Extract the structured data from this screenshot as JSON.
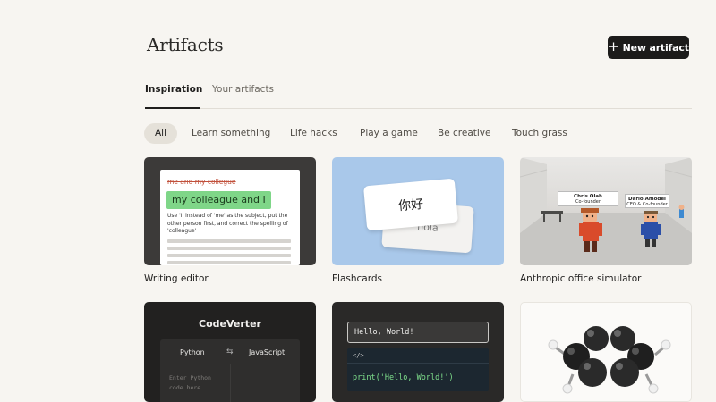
{
  "header": {
    "title": "Artifacts",
    "new_button_label": "New artifact"
  },
  "tabs": [
    {
      "label": "Inspiration",
      "active": true
    },
    {
      "label": "Your artifacts",
      "active": false
    }
  ],
  "filters": [
    {
      "label": "All",
      "active": true
    },
    {
      "label": "Learn something",
      "active": false
    },
    {
      "label": "Life hacks",
      "active": false
    },
    {
      "label": "Play a game",
      "active": false
    },
    {
      "label": "Be creative",
      "active": false
    },
    {
      "label": "Touch grass",
      "active": false
    }
  ],
  "cards": [
    {
      "label": "Writing editor",
      "preview": {
        "original": "me and my collegue",
        "corrected": "my colleague and I",
        "hint": "Use 'I' instead of 'me' as the subject, put the other person first, and correct the spelling of 'colleague'"
      }
    },
    {
      "label": "Flashcards",
      "preview": {
        "front": "你好",
        "back": "hola"
      }
    },
    {
      "label": "Anthropic office simulator",
      "preview": {
        "sign_left_name": "Chris Olah",
        "sign_left_role": "Co-founder",
        "sign_right_name": "Dario Amodei",
        "sign_right_role": "CEO & Co-founder"
      }
    },
    {
      "label": "",
      "preview": {
        "title": "CodeVerter",
        "from_lang": "Python",
        "swap_icon": "⇆",
        "to_lang": "JavaScript",
        "input_placeholder": "Enter Python code here..."
      }
    },
    {
      "label": "",
      "preview": {
        "input_text": "Hello, World!",
        "code_tag": "</>",
        "code": "print('Hello, World!')"
      }
    },
    {
      "label": "",
      "preview": {
        "type": "3d molecule model"
      }
    }
  ],
  "colors": {
    "background": "#f7f5f1",
    "primary_button": "#1c1b1a",
    "active_chip": "#e5e1d9",
    "correction_highlight": "#7fd688",
    "strike_text": "#c1503b",
    "flashcard_bg": "#a9c8ea",
    "code_green": "#7fe08c"
  }
}
